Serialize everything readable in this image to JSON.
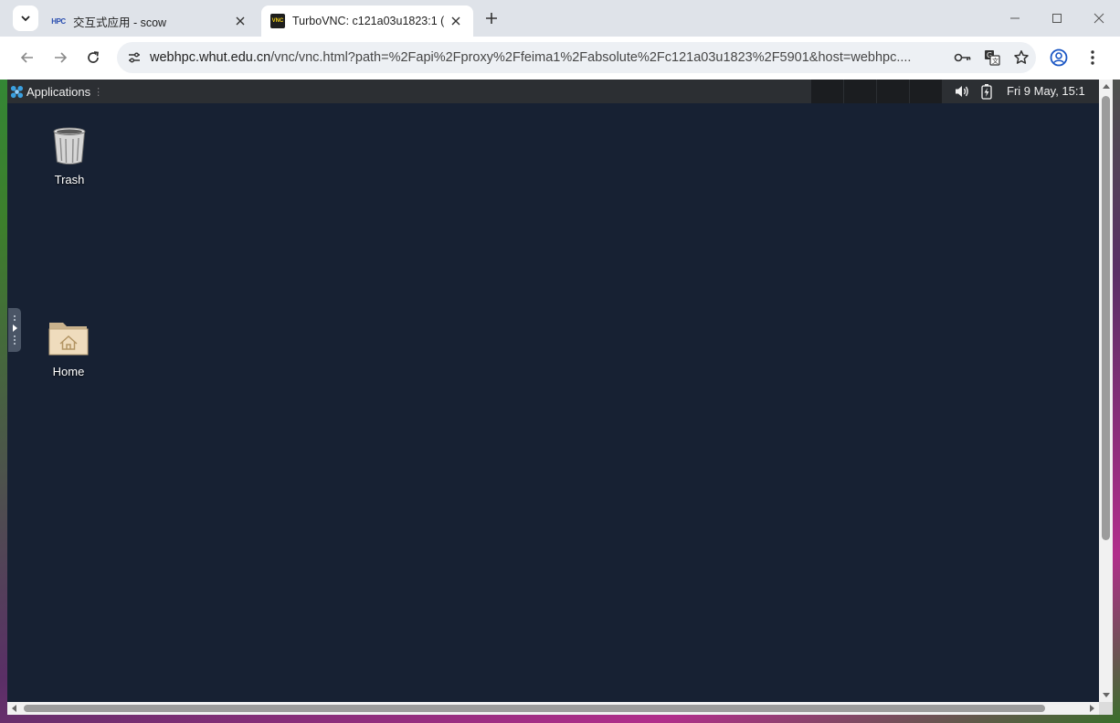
{
  "browser": {
    "tabs": [
      {
        "title": "交互式应用 - scow",
        "favicon": "HPC",
        "active": false
      },
      {
        "title": "TurboVNC: c121a03u1823:1 (",
        "favicon": "VNC",
        "active": true
      }
    ],
    "address_bar": {
      "domain": "webhpc.whut.edu.cn",
      "path": "/vnc/vnc.html?path=%2Fapi%2Fproxy%2Ffeima1%2Fabsolute%2Fc121a03u1823%2F5901&host=webhpc...."
    }
  },
  "desktop": {
    "panel": {
      "applications_label": "Applications",
      "clock": "Fri  9 May, 15:1"
    },
    "icons": [
      {
        "label": "Trash",
        "icon": "trash-icon"
      },
      {
        "label": "Home",
        "icon": "home-folder-icon"
      }
    ],
    "background_color": "#172133"
  }
}
